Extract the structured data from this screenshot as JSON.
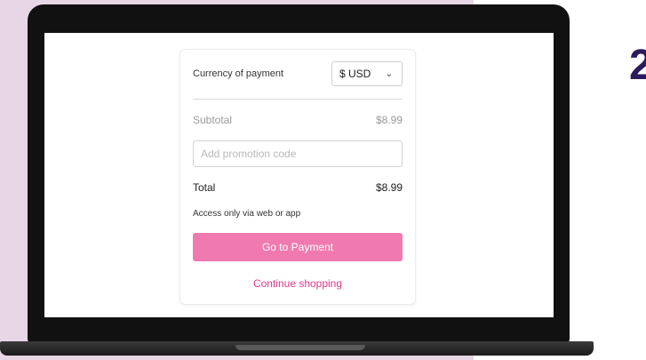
{
  "side_text": "2",
  "checkout": {
    "currency_label": "Currency of payment",
    "currency_value": "$ USD",
    "subtotal_label": "Subtotal",
    "subtotal_value": "$8.99",
    "promo_placeholder": "Add promotion code",
    "promo_value": "",
    "total_label": "Total",
    "total_value": "$8.99",
    "access_note": "Access only via web or app",
    "pay_button_label": "Go to Payment",
    "continue_label": "Continue shopping"
  },
  "colors": {
    "page_background": "#e7d6e6",
    "accent_button": "#f07ab0",
    "accent_link": "#e0388b",
    "laptop_body": "#111111"
  }
}
